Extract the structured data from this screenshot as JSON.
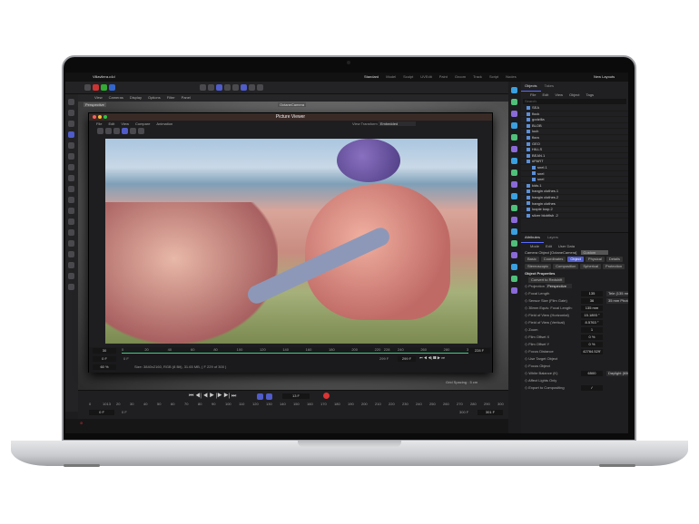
{
  "app": {
    "file_tab": "Villavilera.c4d",
    "layouts": [
      "Standard",
      "Model",
      "Sculpt",
      "UVEdit",
      "Paint",
      "Groom",
      "Track",
      "Script",
      "Nodes"
    ],
    "active_layout": "Standard",
    "new_layouts": "New Layouts"
  },
  "viewport": {
    "menu": [
      "View",
      "Cameras",
      "Display",
      "Options",
      "Filter",
      "Panel"
    ],
    "label": "Perspective",
    "camera": "OctaneCamera",
    "grid_spacing": "Grid Spacing : 5 cm"
  },
  "picture_viewer": {
    "title": "Picture Viewer",
    "menu": [
      "File",
      "Edit",
      "View",
      "Compare",
      "Animation"
    ],
    "view_transform_label": "View Transform",
    "view_transform": "Embedded",
    "ruler": [
      "0",
      "20",
      "40",
      "60",
      "80",
      "100",
      "120",
      "140",
      "160",
      "180",
      "200",
      "220",
      "228",
      "240",
      "260",
      "280",
      "300"
    ],
    "left_fields": [
      "30",
      "0 F",
      "60 %"
    ],
    "start": "0 F",
    "end_field": "228 F",
    "cur1": "299 F",
    "cur2": "299 F",
    "info": "Size: 3840x2160, RGB (8 Bit), 31.65 MB,  ( F 229 of 300 )"
  },
  "timeline": {
    "frame": "13 F",
    "ruler": [
      "0",
      "10",
      "13",
      "20",
      "30",
      "40",
      "50",
      "60",
      "70",
      "80",
      "90",
      "100",
      "110",
      "120",
      "130",
      "140",
      "150",
      "160",
      "170",
      "180",
      "190",
      "200",
      "210",
      "220",
      "230",
      "240",
      "250",
      "260",
      "270",
      "280",
      "290",
      "300"
    ],
    "start": "0 F",
    "start2": "0 F",
    "end": "300 F",
    "end2": "301 F"
  },
  "objects": {
    "tabs": [
      "Objects",
      "Takes"
    ],
    "menu": [
      "File",
      "Edit",
      "View",
      "Object",
      "Tags"
    ],
    "search_placeholder": "Search",
    "items": [
      "SEA",
      "flock",
      "godzilla",
      "BLOB",
      "loch",
      "flora",
      "GEO",
      "HILLS",
      "BEAN.1",
      "#PART",
      "snel.1",
      "snel",
      "snel",
      "kids.1",
      "hangin clothes.1",
      "hangin clothes.2",
      "hangin clothes",
      "loopie loop.2",
      "silver blobfish .2"
    ]
  },
  "attributes": {
    "tabs": [
      "Attributes",
      "Layers"
    ],
    "menu": [
      "Mode",
      "Edit",
      "User Data"
    ],
    "object": "Camera Object [OctaneCamera]",
    "preset": "Custom",
    "prop_tabs": [
      "Basic",
      "Coordinates",
      "Object",
      "Physical",
      "Details",
      "Stereoscopic",
      "Composition",
      "Spherical",
      "Protection"
    ],
    "active_tab": "Object",
    "section": "Object Properties",
    "convert": "Convert to Redshift",
    "projection_label": "Projection",
    "projection": "Perspective",
    "props": [
      {
        "label": "Focal Length",
        "value": "135",
        "extra": "Tele (135 mm)"
      },
      {
        "label": "Sensor Size (Film Gate)",
        "value": "36",
        "extra": "35 mm Photo"
      },
      {
        "label": "35mm Equiv. Focal Length:",
        "value": "135 mm",
        "extra": ""
      },
      {
        "label": "Field of View (Horizontal)",
        "value": "15.1893 °",
        "extra": ""
      },
      {
        "label": "Field of View (Vertical)",
        "value": "8.5763 °",
        "extra": ""
      },
      {
        "label": "Zoom",
        "value": "1",
        "extra": ""
      },
      {
        "label": "Film Offset X",
        "value": "0 %",
        "extra": ""
      },
      {
        "label": "Film Offset Y",
        "value": "0 %",
        "extra": ""
      },
      {
        "label": "Focus Distance",
        "value": "42764.529'",
        "extra": ""
      },
      {
        "label": "Use Target Object",
        "value": "",
        "extra": ""
      },
      {
        "label": "Focus Object",
        "value": "",
        "extra": ""
      },
      {
        "label": "White Balance (K)",
        "value": "6500",
        "extra": "Daylight (6500 K)"
      },
      {
        "label": "Affect Lights Only",
        "value": "",
        "extra": ""
      },
      {
        "label": "Export to Compositing",
        "value": "✓",
        "extra": ""
      }
    ]
  },
  "colors": {
    "accent": "#4f5cc9",
    "timeline_green": "#3fcf7f",
    "close": "#ff5f57",
    "min": "#febc2e",
    "max": "#28c840"
  }
}
